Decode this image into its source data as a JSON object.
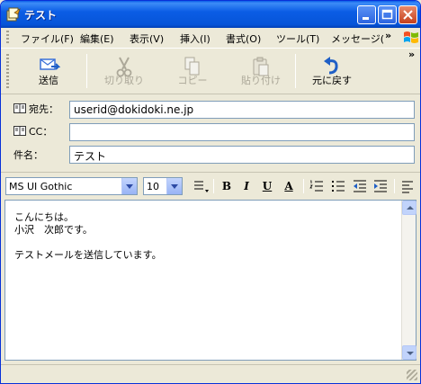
{
  "window": {
    "title": "テスト"
  },
  "menu": {
    "items": [
      "ファイル(F)",
      "編集(E)",
      "表示(V)",
      "挿入(I)",
      "書式(O)",
      "ツール(T)",
      "メッセージ("
    ],
    "overflow": "»"
  },
  "toolbar": {
    "send": "送信",
    "cut": "切り取り",
    "copy": "コピー",
    "paste": "貼り付け",
    "undo": "元に戻す",
    "overflow": "»"
  },
  "fields": {
    "to_label": "宛先：",
    "to_value": "userid@dokidoki.ne.jp",
    "cc_label": "CC：",
    "cc_value": "",
    "subject_label": "件名：",
    "subject_value": "テスト"
  },
  "format": {
    "font": "MS UI Gothic",
    "size": "10",
    "bold": "B",
    "italic": "I",
    "underline": "U",
    "color": "A"
  },
  "body": {
    "text": "こんにちは。\n小沢　次郎です。\n\nテストメールを送信しています。"
  },
  "colors": {
    "title_bar": "#0b5de5",
    "undo_icon": "#1f5fc6",
    "send_icon": "#3a70d8"
  }
}
